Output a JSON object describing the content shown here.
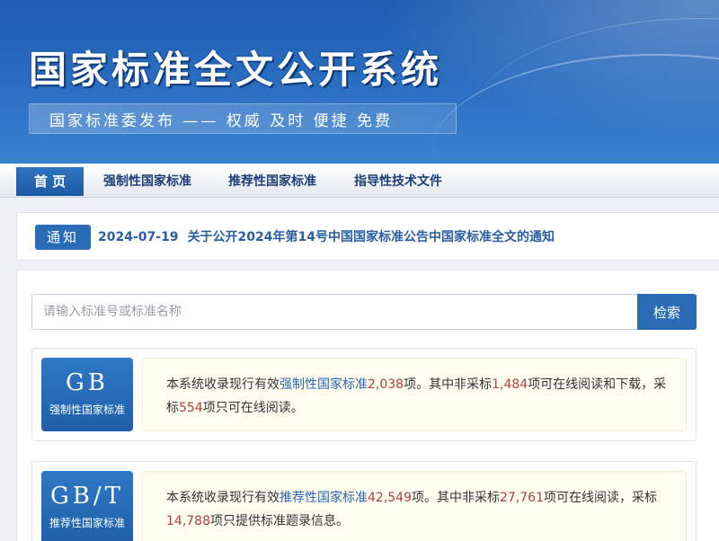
{
  "banner": {
    "title": "国家标准全文公开系统",
    "slogan": "国家标准委发布 —— 权威 及时 便捷 免费"
  },
  "nav": {
    "items": [
      {
        "label": "首 页",
        "active": true
      },
      {
        "label": "强制性国家标准",
        "active": false
      },
      {
        "label": "推荐性国家标准",
        "active": false
      },
      {
        "label": "指导性技术文件",
        "active": false
      }
    ]
  },
  "notice": {
    "badge": "通知",
    "date": "2024-07-19",
    "text": "关于公开2024年第14号中国国家标准公告中国家标准全文的通知"
  },
  "search": {
    "placeholder": "请输入标准号或标准名称",
    "button_label": "检索"
  },
  "standards": [
    {
      "code": "GB",
      "label": "强制性国家标准",
      "desc": {
        "p1": "本系统收录现行有效",
        "link": "强制性国家标准",
        "total": "2,038",
        "p2": "项。其中非采标",
        "n1": "1,484",
        "p3": "项可在线阅读和下载，采标",
        "n2": "554",
        "p4": "项只可在线阅读。"
      }
    },
    {
      "code": "GB/T",
      "label": "推荐性国家标准",
      "desc": {
        "p1": "本系统收录现行有效",
        "link": "推荐性国家标准",
        "total": "42,549",
        "p2": "项。其中非采标",
        "n1": "27,761",
        "p3": "项可在线阅读，采标",
        "n2": "14,788",
        "p4": "项只提供标准题录信息。"
      }
    }
  ],
  "colors": {
    "primary": "#2a6db6",
    "highlight_number": "#b0413e",
    "highlight_link": "#2b67b0"
  }
}
